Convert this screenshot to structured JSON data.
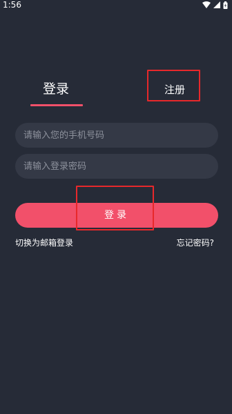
{
  "status_bar": {
    "time": "1:56",
    "icons": [
      "wifi-icon",
      "signal-icon",
      "battery-icon"
    ]
  },
  "tabs": {
    "login_label": "登录",
    "register_label": "注册"
  },
  "form": {
    "phone_placeholder": "请输入您的手机号码",
    "password_placeholder": "请输入登录密码",
    "submit_label": "登录"
  },
  "links": {
    "email_login": "切换为邮箱登录",
    "forgot_password": "忘记密码?"
  },
  "colors": {
    "background": "#262b37",
    "accent": "#f2506a",
    "input_bg": "#343946",
    "highlight": "#e8282b"
  }
}
